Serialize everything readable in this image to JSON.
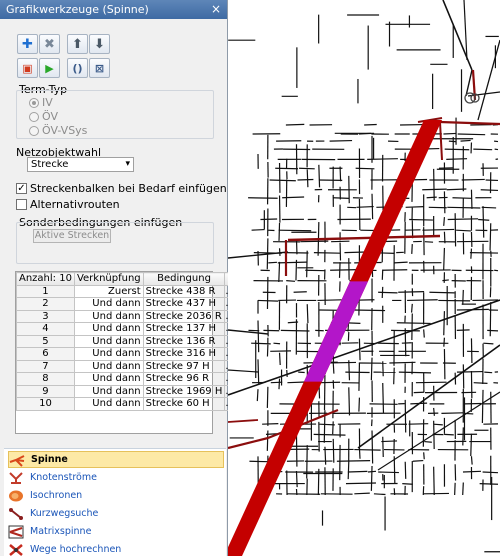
{
  "window": {
    "title": "Grafikwerkzeuge (Spinne)",
    "close_glyph": "×"
  },
  "toolbar": {
    "row1": [
      {
        "name": "add-icon",
        "glyph": "✚",
        "color": "#1f6fd1"
      },
      {
        "name": "delete-icon",
        "glyph": "✖",
        "color": "#7a8899"
      },
      {
        "name": "move-up-icon",
        "glyph": "⬆",
        "color": "#4a5866"
      },
      {
        "name": "move-down-icon",
        "glyph": "⬇",
        "color": "#4a5866"
      }
    ],
    "row2": [
      {
        "name": "new-document-icon",
        "glyph": "▣",
        "color": "#d23a1e"
      },
      {
        "name": "play-icon",
        "glyph": "▶",
        "color": "#2aa82a"
      },
      {
        "name": "parentheses-icon",
        "glyph": "()",
        "color": "#3b5b8a"
      },
      {
        "name": "bracket-x-icon",
        "glyph": "⊠",
        "color": "#3b5b8a"
      }
    ]
  },
  "term_type": {
    "label": "Term-Typ",
    "options": [
      {
        "label": "IV",
        "selected": true
      },
      {
        "label": "ÖV",
        "selected": false
      },
      {
        "label": "ÖV-VSys",
        "selected": false
      }
    ]
  },
  "network": {
    "label": "Netzobjektwahl",
    "selected": "Strecke"
  },
  "checkboxes": {
    "insert_bars": {
      "label": "Streckenbalken bei Bedarf einfügen",
      "checked": true
    },
    "alternative_routes": {
      "label": "Alternativrouten",
      "checked": false
    }
  },
  "special": {
    "label": "Sonderbedingungen einfügen",
    "button": "Aktive Strecken"
  },
  "grid": {
    "headers": [
      "Anzahl: 10",
      "Verknüpfung",
      "Bedingung"
    ],
    "rows": [
      {
        "n": "1",
        "link": "Zuerst",
        "cond": "Strecke 438 R"
      },
      {
        "n": "2",
        "link": "Und dann",
        "cond": "Strecke 437 H"
      },
      {
        "n": "3",
        "link": "Und dann",
        "cond": "Strecke 2036 R"
      },
      {
        "n": "4",
        "link": "Und dann",
        "cond": "Strecke 137 H"
      },
      {
        "n": "5",
        "link": "Und dann",
        "cond": "Strecke 136 R"
      },
      {
        "n": "6",
        "link": "Und dann",
        "cond": "Strecke 316 H"
      },
      {
        "n": "7",
        "link": "Und dann",
        "cond": "Strecke 97 H"
      },
      {
        "n": "8",
        "link": "Und dann",
        "cond": "Strecke 96 R"
      },
      {
        "n": "9",
        "link": "Und dann",
        "cond": "Strecke 1969 H"
      },
      {
        "n": "10",
        "link": "Und dann",
        "cond": "Strecke 60 H"
      }
    ],
    "ellipsis": "..."
  },
  "tools": [
    {
      "label": "Spinne",
      "selected": true,
      "icon": "spider-icon",
      "color": "#d9471b"
    },
    {
      "label": "Knotenströme",
      "selected": false,
      "icon": "node-flows-icon",
      "color": "#c23b2a"
    },
    {
      "label": "Isochronen",
      "selected": false,
      "icon": "isochrones-icon",
      "color": "#e8742a"
    },
    {
      "label": "Kurzwegsuche",
      "selected": false,
      "icon": "shortest-path-icon",
      "color": "#8a1f1f"
    },
    {
      "label": "Matrixspinne",
      "selected": false,
      "icon": "matrix-spider-icon",
      "color": "#b0281e"
    },
    {
      "label": "Wege hochrechnen",
      "selected": false,
      "icon": "path-extrapolation-icon",
      "color": "#c62a1e"
    }
  ],
  "map": {
    "background": "#ffffff",
    "network_color": "#111111",
    "main_road_color": "#8b0d0d",
    "spider_band_color": "#c40000",
    "highlight_color": "#b316c9"
  }
}
